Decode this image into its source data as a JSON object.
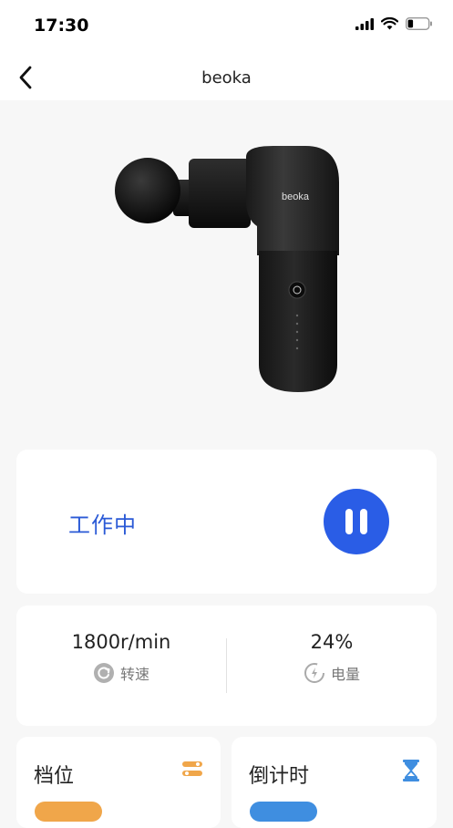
{
  "status_bar": {
    "time": "17:30"
  },
  "nav": {
    "title": "beoka"
  },
  "device": {
    "brand_text": "beoka"
  },
  "work_card": {
    "state_label": "工作中"
  },
  "stats": {
    "speed_value": "1800r/min",
    "speed_label": "转速",
    "battery_value": "24%",
    "battery_label": "电量"
  },
  "gear_card": {
    "title": "档位"
  },
  "timer_card": {
    "title": "倒计时"
  },
  "colors": {
    "accent_blue": "#2a5de6",
    "work_label_blue": "#2b5ad6",
    "gear_orange": "#f0a64a",
    "timer_blue": "#3f8ee0"
  }
}
